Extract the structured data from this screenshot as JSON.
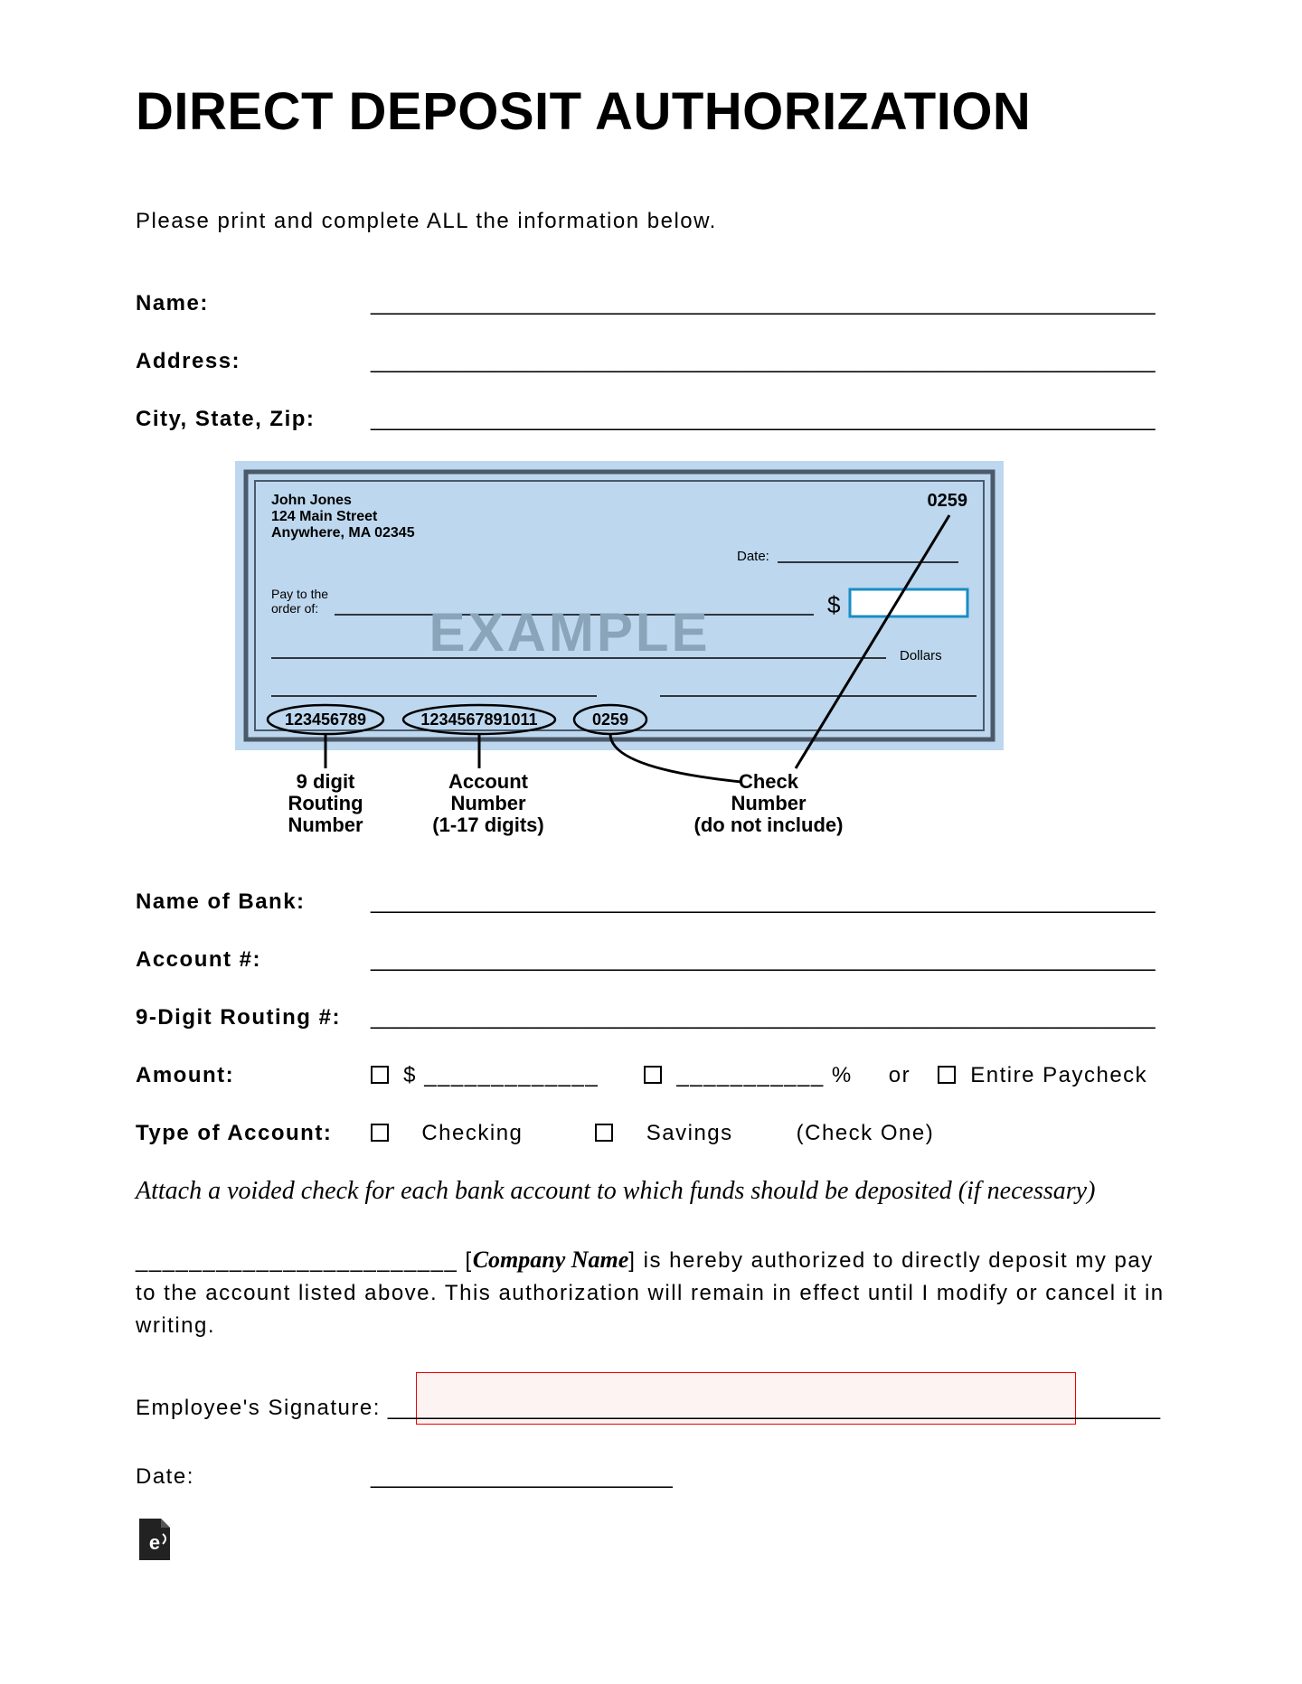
{
  "title": "DIRECT DEPOSIT AUTHORIZATION",
  "instruction": "Please print and complete ALL the information below.",
  "fields1": {
    "name": "Name:",
    "address": "Address:",
    "csz": "City, State, Zip:"
  },
  "check": {
    "holder_name": "John Jones",
    "holder_addr1": "124 Main Street",
    "holder_addr2": "Anywhere, MA 02345",
    "check_no": "0259",
    "date_label": "Date:",
    "pay_label1": "Pay to the",
    "pay_label2": "order of:",
    "dollar_sign": "$",
    "watermark": "EXAMPLE",
    "dollars_label": "Dollars",
    "routing": "123456789",
    "account": "1234567891011",
    "bottom_check": "0259",
    "label_routing1": "9 digit",
    "label_routing2": "Routing",
    "label_routing3": "Number",
    "label_account1": "Account",
    "label_account2": "Number",
    "label_account3": "(1-17 digits)",
    "label_checkno1": "Check",
    "label_checkno2": "Number",
    "label_checkno3": "(do not include)"
  },
  "fields2": {
    "bank": "Name of Bank:",
    "account": "Account #:",
    "routing": "9-Digit Routing #:",
    "amount": "Amount:",
    "dollar": "$ _____________",
    "percent": "___________ %",
    "or": "or",
    "entire": "Entire Paycheck",
    "type": "Type of Account:",
    "checking": "Checking",
    "savings": "Savings",
    "checkone": "(Check One)"
  },
  "voided": "Attach a voided check for each bank account to which funds should be deposited (if necessary)",
  "auth1": "________________________ [",
  "auth_company": "Company Name",
  "auth2": "] is hereby authorized to directly deposit my pay to the account listed above. This authorization will remain in effect until I modify or cancel it in writing.",
  "sig_label": "Employee's Signature:",
  "date_label": "Date:",
  "line_long": "_________________________________________________________________",
  "line_mid": "_________________________________________________________",
  "line_sig": "________________________________________________________________",
  "line_date": "_________________________"
}
